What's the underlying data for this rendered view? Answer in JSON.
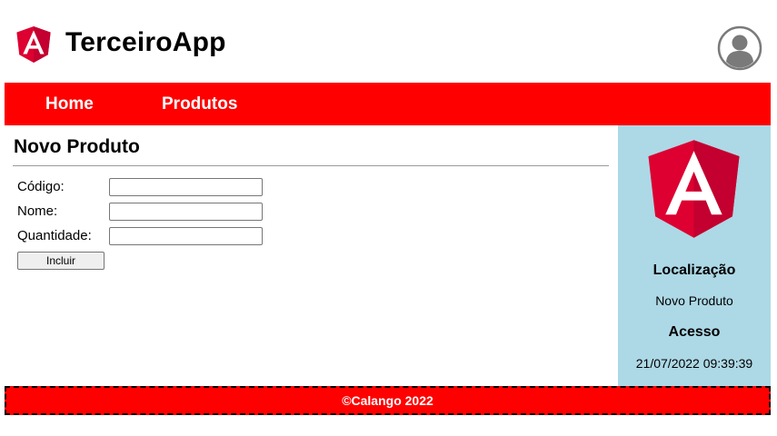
{
  "header": {
    "app_title": "TerceiroApp",
    "logo_icon": "angular-logo-icon",
    "avatar_icon": "user-avatar-icon"
  },
  "nav": {
    "items": [
      {
        "label": "Home"
      },
      {
        "label": "Produtos"
      }
    ]
  },
  "main": {
    "title": "Novo Produto",
    "form": {
      "codigo_label": "Código:",
      "codigo_value": "",
      "nome_label": "Nome:",
      "nome_value": "",
      "quantidade_label": "Quantidade:",
      "quantidade_value": "",
      "submit_label": "Incluir"
    }
  },
  "sidebar": {
    "logo_icon": "angular-logo-icon",
    "location_heading": "Localização",
    "location_value": "Novo Produto",
    "access_heading": "Acesso",
    "access_value": "21/07/2022 09:39:39"
  },
  "footer": {
    "text": "©Calango 2022"
  },
  "colors": {
    "navbar": "#ff0000",
    "footer": "#ff0000",
    "sidebar": "#add8e6",
    "logo_red": "#dd0031",
    "logo_dark_red": "#c3002f"
  }
}
